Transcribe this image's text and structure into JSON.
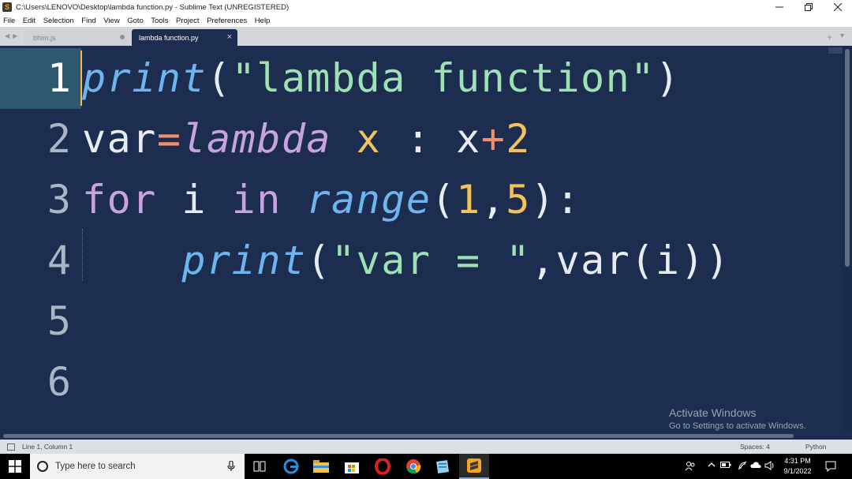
{
  "window": {
    "title": "C:\\Users\\LENOVO\\Desktop\\lambda function.py - Sublime Text (UNREGISTERED)",
    "app_icon_glyph": "S",
    "controls": [
      "minimize-icon",
      "restore-icon",
      "close-icon"
    ]
  },
  "menu": {
    "items": [
      "File",
      "Edit",
      "Selection",
      "Find",
      "View",
      "Goto",
      "Tools",
      "Project",
      "Preferences",
      "Help"
    ]
  },
  "tabs": {
    "nav_left": "◀",
    "nav_right": "▶",
    "items": [
      {
        "label": "bhim.js",
        "active": false
      },
      {
        "label": "lambda function.py",
        "active": true
      }
    ],
    "close_glyph": "×",
    "add_glyph": "+",
    "menu_glyph": "▼"
  },
  "editor": {
    "line_numbers": [
      "1",
      "2",
      "3",
      "4",
      "5",
      "6"
    ],
    "current_line": 1,
    "code": {
      "line1": {
        "fn": "print",
        "open": "(",
        "str": "\"lambda function\"",
        "close": ")"
      },
      "line2": {
        "var": "var",
        "eq": "=",
        "kw": "lambda",
        "sp": " ",
        "param": "x",
        "colon": " : x",
        "plus": "+",
        "num": "2"
      },
      "line3": {
        "kw_for": "for",
        "mid": " i ",
        "kw_in": "in",
        "sp": " ",
        "fn": "range",
        "open": "(",
        "n1": "1",
        "comma": ",",
        "n2": "5",
        "close": "):"
      },
      "line4": {
        "indent": "    ",
        "fn": "print",
        "open": "(",
        "str": "\"var = \"",
        "rest": ",var(i))"
      }
    }
  },
  "watermark": {
    "line1": "Activate Windows",
    "line2": "Go to Settings to activate Windows."
  },
  "status": {
    "position": "Line 1, Column 1",
    "spaces": "Spaces: 4",
    "syntax": "Python"
  },
  "taskbar": {
    "search_placeholder": "Type here to search",
    "pinned": [
      "task-view-icon",
      "edge-icon",
      "file-explorer-icon",
      "store-icon",
      "opera-icon",
      "chrome-icon",
      "notepad-icon",
      "sublime-text-icon"
    ],
    "clock_time": "4:31 PM",
    "clock_date": "9/1/2022"
  },
  "colors": {
    "editor_bg": "#1c2d50",
    "function": "#6eb4ef",
    "keyword": "#c7a3e2",
    "string": "#9fe0b4",
    "number": "#f2c35c",
    "operator": "#f08f6a"
  }
}
